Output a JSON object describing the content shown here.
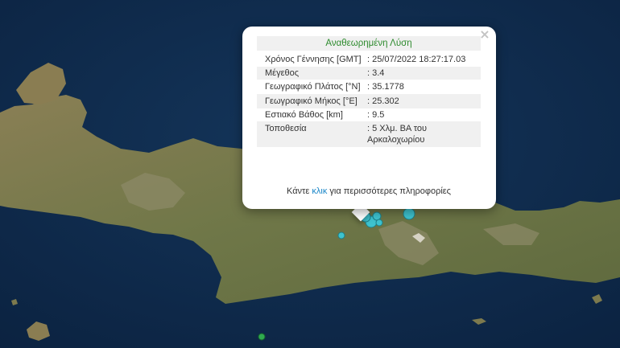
{
  "popup": {
    "close_label": "×",
    "title": "Αναθεωρημένη Λύση",
    "rows": [
      {
        "label": "Χρόνος Γέννησης [GMT]",
        "value": ": 25/07/2022 18:27:17.03"
      },
      {
        "label": "Μέγεθος",
        "value": ": 3.4"
      },
      {
        "label": "Γεωγραφικό Πλάτος [°N]",
        "value": ": 35.1778"
      },
      {
        "label": "Γεωγραφικό Μήκος [°E]",
        "value": ": 25.302"
      },
      {
        "label": "Εστιακό Βάθος [km]",
        "value": ": 9.5"
      },
      {
        "label": "Τοποθεσία",
        "value": ": 5 Χλμ. ΒΑ του Αρκαλοχωρίου"
      }
    ],
    "footer_before": "Κάντε ",
    "footer_link": "κλικ",
    "footer_after": " για περισσότερες πληροφορίες"
  },
  "colors": {
    "sea": "#0e2a4a",
    "land": "#7d7a4e",
    "marker": "#3ec3cf",
    "marker_green": "#2faa4f",
    "title_text": "#2e8b2e",
    "link": "#1a86c8"
  },
  "markers": {
    "main_shock_icon": "earthquake-circle-icon",
    "distant_event_icon": "green-dot-icon"
  }
}
